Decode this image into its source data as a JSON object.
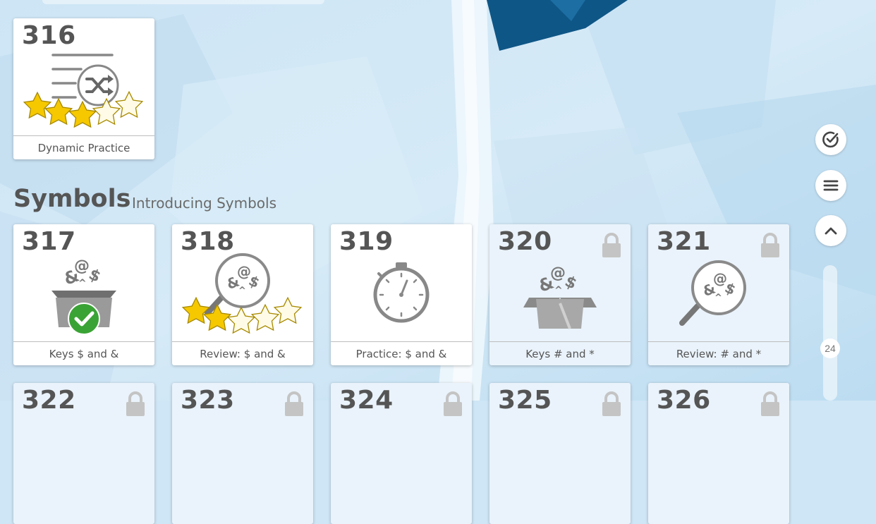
{
  "top_card": {
    "number": "316",
    "label": "Dynamic Practice",
    "stars_filled": 3,
    "stars_total": 5
  },
  "section": {
    "title": "Symbols",
    "subtitle": "Introducing Symbols"
  },
  "cards": [
    {
      "number": "317",
      "label": "Keys $ and &",
      "locked": false
    },
    {
      "number": "318",
      "label": "Review: $ and &",
      "locked": false,
      "stars_filled": 2,
      "stars_total": 5
    },
    {
      "number": "319",
      "label": "Practice: $ and &",
      "locked": false
    },
    {
      "number": "320",
      "label": "Keys # and *",
      "locked": true
    },
    {
      "number": "321",
      "label": "Review: # and *",
      "locked": true
    }
  ],
  "next_row": [
    "322",
    "323",
    "324",
    "325",
    "326"
  ],
  "side_controls": {
    "scroll_value": "24"
  },
  "colors": {
    "star_gold": "#f5c800",
    "check_green": "#3aa335",
    "icon_gray": "#888888",
    "lock_gray": "#c4c4c4",
    "text": "#555555"
  }
}
